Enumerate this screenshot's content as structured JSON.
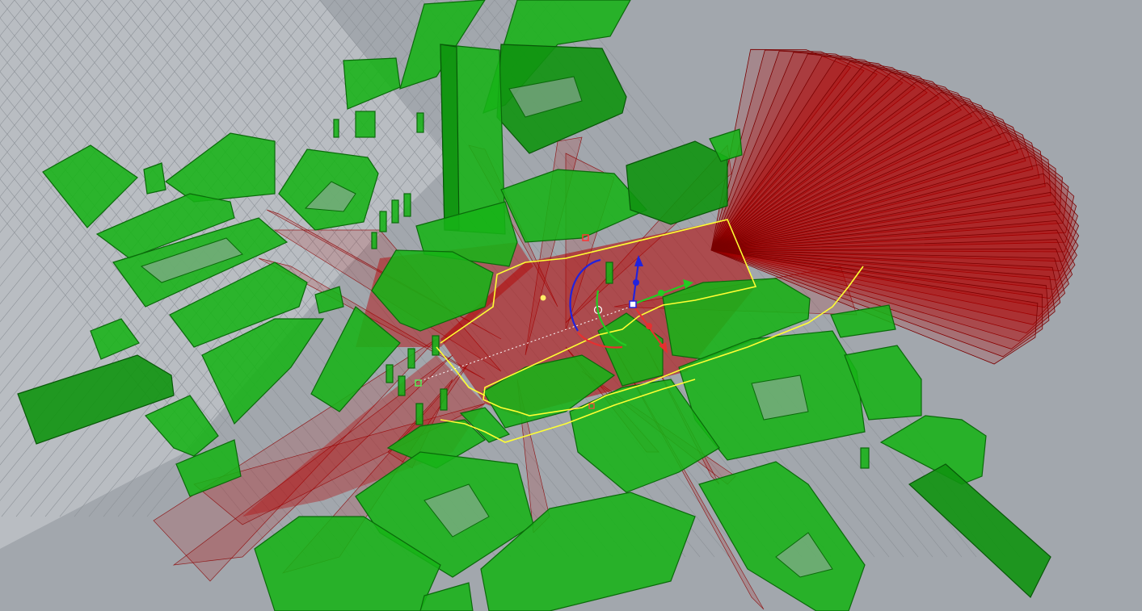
{
  "viewport": {
    "view": "Perspective",
    "background_color": "#a2a7ad",
    "grid_color": "#8e9399",
    "grid_fill": "#b9bdc2"
  },
  "scene": {
    "building_color": "#17b317",
    "building_edge_color": "#0a6a0a",
    "ray_color": "#b40000",
    "boundary_color": "#ffff33",
    "ray_fan_count": 40
  },
  "gizmo": {
    "x_axis_color": "#e53030",
    "y_axis_color": "#22cc22",
    "z_axis_color": "#2222dd",
    "pivot_color": "#ffffff"
  },
  "markers": {
    "point_color": "#ffee66",
    "origin_marker_color": "#ffffff",
    "control_point_color": "#ff3333"
  }
}
